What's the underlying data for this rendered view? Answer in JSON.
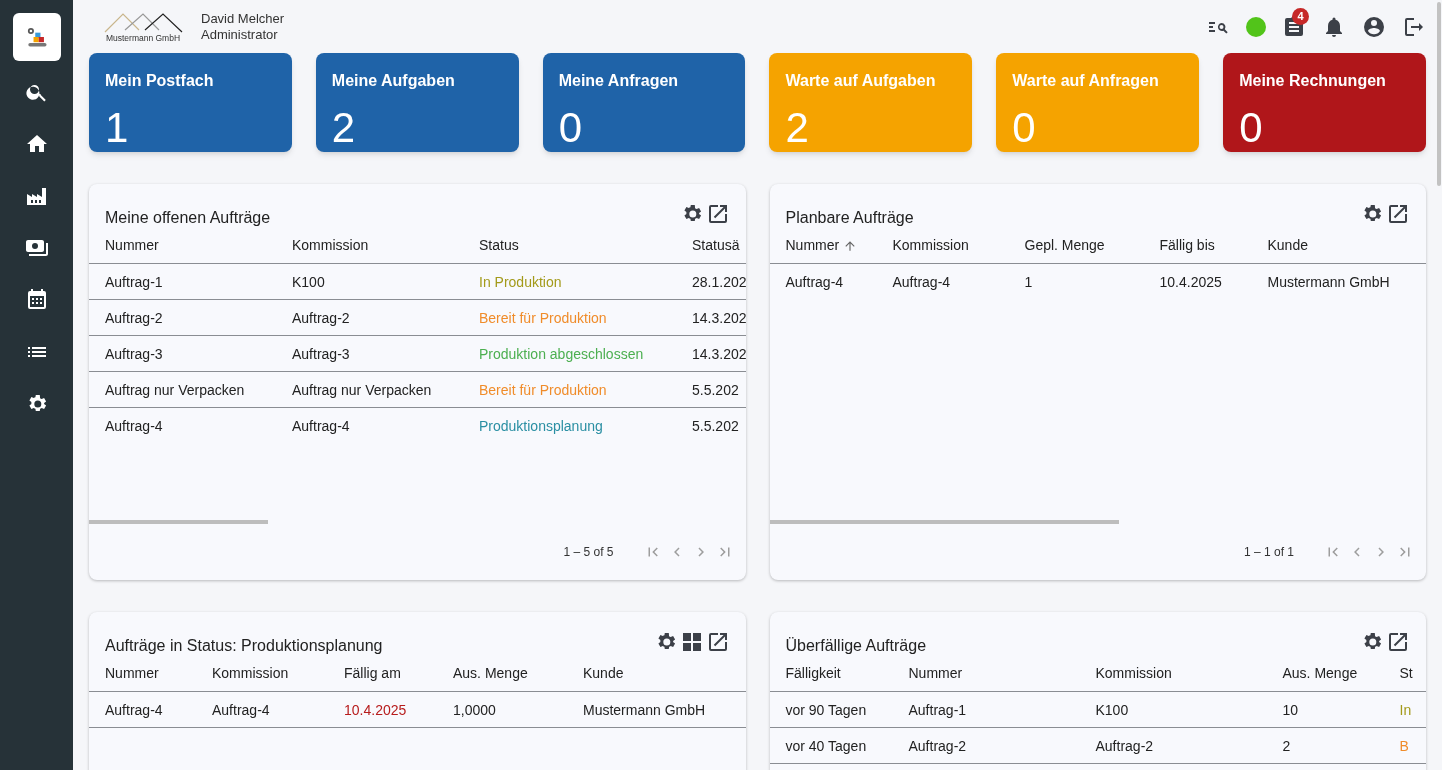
{
  "header": {
    "company": "Mustermann GmbH",
    "user_name": "David Melcher",
    "user_role": "Administrator",
    "notification_count": "4"
  },
  "tiles": [
    {
      "title": "Mein Postfach",
      "count": "1",
      "color": "#1f63a8"
    },
    {
      "title": "Meine Aufgaben",
      "count": "2",
      "color": "#1f63a8"
    },
    {
      "title": "Meine Anfragen",
      "count": "0",
      "color": "#1f63a8"
    },
    {
      "title": "Warte auf Aufgaben",
      "count": "2",
      "color": "#f5a300"
    },
    {
      "title": "Warte auf Anfragen",
      "count": "0",
      "color": "#f5a300"
    },
    {
      "title": "Meine Rechnungen",
      "count": "0",
      "color": "#b0161a"
    }
  ],
  "cards": [
    {
      "title": "Meine offenen Aufträge",
      "columns": [
        {
          "label": "Nummer"
        },
        {
          "label": "Kommission"
        },
        {
          "label": "Status"
        },
        {
          "label": "Statusä"
        }
      ],
      "rows": [
        [
          {
            "text": "Auftrag-1"
          },
          {
            "text": "K100"
          },
          {
            "text": "In Produktion",
            "color": "#a39a1a"
          },
          {
            "text": "28.1.202"
          }
        ],
        [
          {
            "text": "Auftrag-2"
          },
          {
            "text": "Auftrag-2"
          },
          {
            "text": "Bereit für Produktion",
            "color": "#f08c2a"
          },
          {
            "text": "14.3.202"
          }
        ],
        [
          {
            "text": "Auftrag-3"
          },
          {
            "text": "Auftrag-3"
          },
          {
            "text": "Produktion abgeschlossen",
            "color": "#4caf50"
          },
          {
            "text": "14.3.202"
          }
        ],
        [
          {
            "text": "Auftrag nur Verpacken"
          },
          {
            "text": "Auftrag nur Verpacken"
          },
          {
            "text": "Bereit für Produktion",
            "color": "#f08c2a"
          },
          {
            "text": "5.5.202"
          }
        ],
        [
          {
            "text": "Auftrag-4"
          },
          {
            "text": "Auftrag-4"
          },
          {
            "text": "Produktionsplanung",
            "color": "#2a8fa3"
          },
          {
            "text": "5.5.202"
          }
        ]
      ],
      "range": "1 – 5 of 5"
    },
    {
      "title": "Planbare Aufträge",
      "columns": [
        {
          "label": "Nummer",
          "sorted": true
        },
        {
          "label": "Kommission"
        },
        {
          "label": "Gepl. Menge"
        },
        {
          "label": "Fällig bis"
        },
        {
          "label": "Kunde"
        }
      ],
      "rows": [
        [
          {
            "text": "Auftrag-4"
          },
          {
            "text": "Auftrag-4"
          },
          {
            "text": "1"
          },
          {
            "text": "10.4.2025"
          },
          {
            "text": "Mustermann GmbH"
          }
        ]
      ],
      "range": "1 – 1 of 1"
    },
    {
      "title": "Aufträge in Status: Produktionsplanung",
      "columns": [
        {
          "label": "Nummer"
        },
        {
          "label": "Kommission"
        },
        {
          "label": "Fällig am"
        },
        {
          "label": "Aus. Menge"
        },
        {
          "label": "Kunde"
        }
      ],
      "rows": [
        [
          {
            "text": "Auftrag-4"
          },
          {
            "text": "Auftrag-4"
          },
          {
            "text": "10.4.2025",
            "color": "#b71c1c"
          },
          {
            "text": "1,0000"
          },
          {
            "text": "Mustermann GmbH"
          }
        ]
      ]
    },
    {
      "title": "Überfällige Aufträge",
      "columns": [
        {
          "label": "Fälligkeit"
        },
        {
          "label": "Nummer"
        },
        {
          "label": "Kommission"
        },
        {
          "label": "Aus. Menge"
        },
        {
          "label": "St"
        }
      ],
      "rows": [
        [
          {
            "text": "vor 90 Tagen"
          },
          {
            "text": "Auftrag-1"
          },
          {
            "text": "K100"
          },
          {
            "text": "10"
          },
          {
            "text": "In",
            "color": "#a39a1a"
          }
        ],
        [
          {
            "text": "vor 40 Tagen"
          },
          {
            "text": "Auftrag-2"
          },
          {
            "text": "Auftrag-2"
          },
          {
            "text": "2"
          },
          {
            "text": "B",
            "color": "#f08c2a"
          }
        ]
      ]
    }
  ]
}
